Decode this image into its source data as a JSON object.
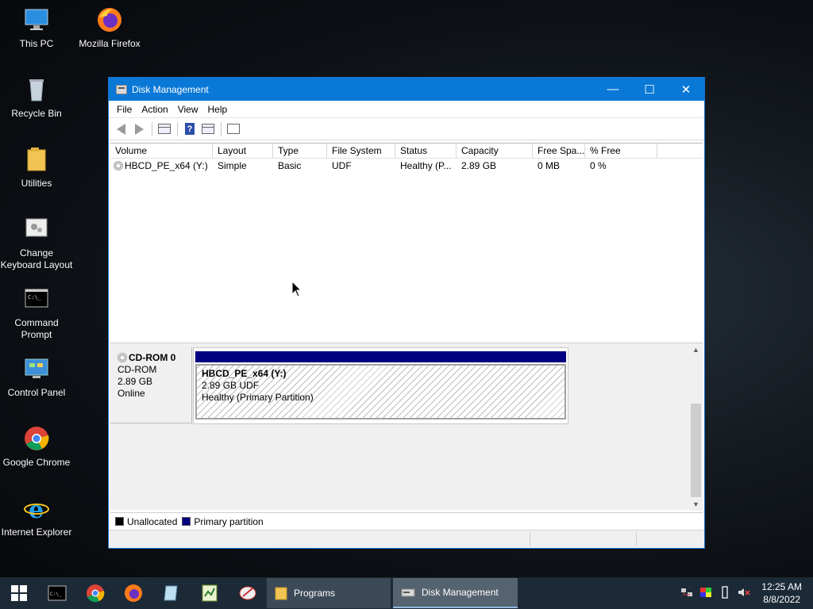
{
  "desktop": {
    "icons": [
      {
        "label": "This PC"
      },
      {
        "label": "Mozilla Firefox"
      },
      {
        "label": "Recycle Bin"
      },
      {
        "label": "Utilities"
      },
      {
        "label": "Change Keyboard Layout"
      },
      {
        "label": "Command Prompt"
      },
      {
        "label": "Control Panel"
      },
      {
        "label": "Google Chrome"
      },
      {
        "label": "Internet Explorer"
      }
    ]
  },
  "window": {
    "title": "Disk Management",
    "menu": [
      "File",
      "Action",
      "View",
      "Help"
    ],
    "columns": [
      "Volume",
      "Layout",
      "Type",
      "File System",
      "Status",
      "Capacity",
      "Free Spa...",
      "% Free"
    ],
    "rows": [
      {
        "volume": "HBCD_PE_x64 (Y:)",
        "layout": "Simple",
        "type": "Basic",
        "file_system": "UDF",
        "status": "Healthy (P...",
        "capacity": "2.89 GB",
        "free_space": "0 MB",
        "percent_free": "0 %"
      }
    ],
    "disk": {
      "name": "CD-ROM 0",
      "kind": "CD-ROM",
      "size": "2.89 GB",
      "state": "Online",
      "partition": {
        "name": "HBCD_PE_x64  (Y:)",
        "size_fs": "2.89 GB UDF",
        "status": "Healthy (Primary Partition)"
      }
    },
    "legend": [
      {
        "label": "Unallocated",
        "color": "#000000"
      },
      {
        "label": "Primary partition",
        "color": "#000080"
      }
    ]
  },
  "taskbar": {
    "buttons": [
      {
        "label": "Programs"
      },
      {
        "label": "Disk Management"
      }
    ],
    "clock": {
      "time": "12:25 AM",
      "date": "8/8/2022"
    }
  },
  "colors": {
    "titlebar": "#0a78d7",
    "taskbar": "#1c2a38",
    "primary_partition": "#000080"
  }
}
